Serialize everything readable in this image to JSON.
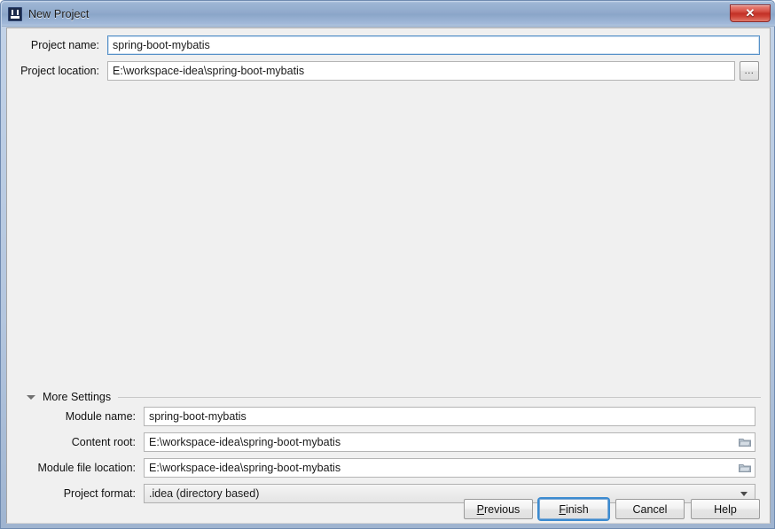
{
  "window": {
    "title": "New Project",
    "icon": "intellij-idea-icon",
    "close_label": "✕"
  },
  "top_form": {
    "fields": [
      {
        "label": "Project name:",
        "value": "spring-boot-mybatis",
        "name": "project-name"
      },
      {
        "label": "Project location:",
        "value": "E:\\workspace-idea\\spring-boot-mybatis",
        "name": "project-location"
      }
    ],
    "browse_label": "..."
  },
  "more_settings": {
    "label": "More Settings",
    "expanded": true,
    "toggle_icon": "chevron-down-icon",
    "fields": [
      {
        "label": "Module name:",
        "value": "spring-boot-mybatis",
        "name": "module-name",
        "type": "text",
        "has_folder_icon": false
      },
      {
        "label": "Content root:",
        "value": "E:\\workspace-idea\\spring-boot-mybatis",
        "name": "content-root",
        "type": "text",
        "has_folder_icon": true
      },
      {
        "label": "Module file location:",
        "value": "E:\\workspace-idea\\spring-boot-mybatis",
        "name": "module-file-location",
        "type": "text",
        "has_folder_icon": true
      },
      {
        "label": "Project format:",
        "value": ".idea (directory based)",
        "name": "project-format",
        "type": "combo",
        "has_folder_icon": false
      }
    ]
  },
  "buttons": {
    "previous": {
      "label": "Previous",
      "mnemonic": "P"
    },
    "finish": {
      "label": "Finish",
      "mnemonic": "F",
      "default": true
    },
    "cancel": {
      "label": "Cancel"
    },
    "help": {
      "label": "Help"
    }
  },
  "colors": {
    "title_bar": "#8fa9cb",
    "close_button": "#c23127",
    "focus_blue": "#3c8bd0",
    "dialog_bg": "#f0f0f0"
  }
}
